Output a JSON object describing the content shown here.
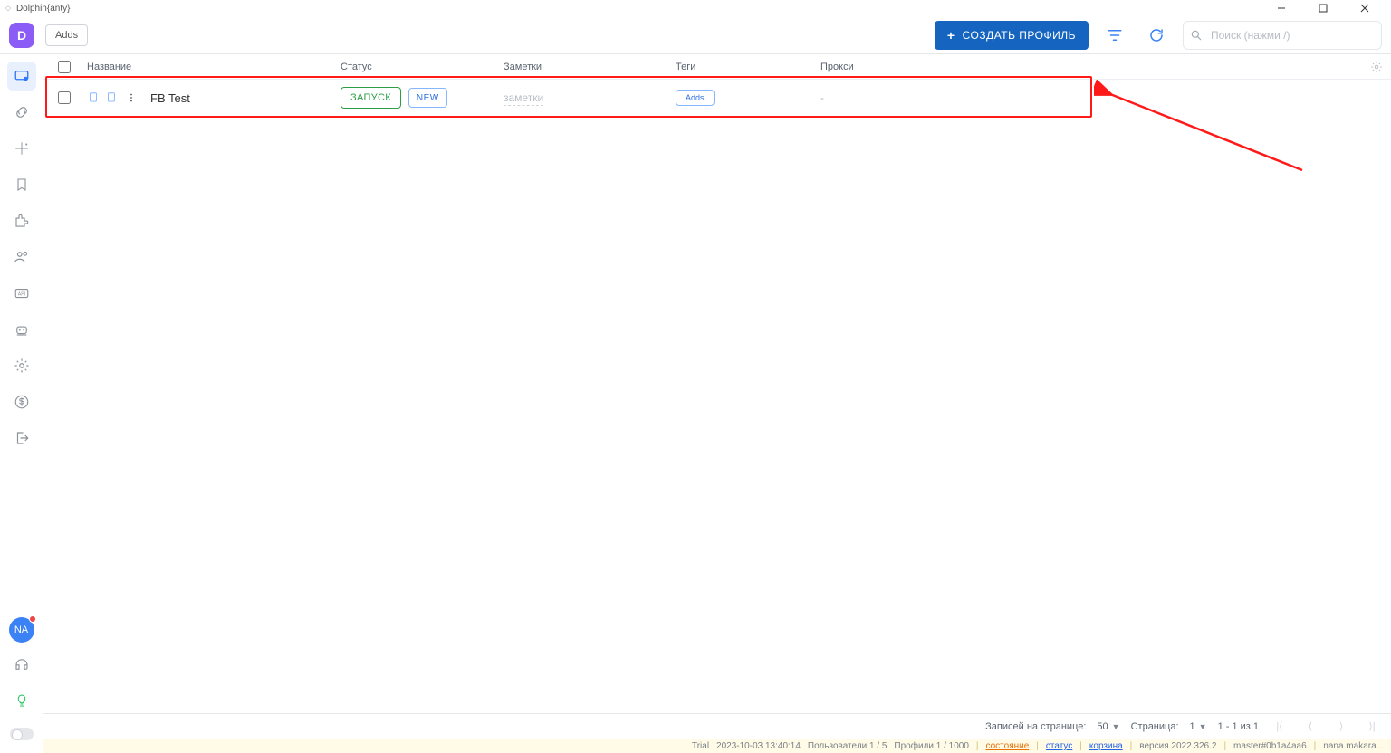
{
  "window": {
    "title": "Dolphin{anty}"
  },
  "topbar": {
    "logo_letter": "D",
    "adds_label": "Adds",
    "create_profile_label": "СОЗДАТЬ ПРОФИЛЬ",
    "search_placeholder": "Поиск (нажми /)"
  },
  "columns": {
    "name": "Название",
    "status": "Статус",
    "notes": "Заметки",
    "tags": "Теги",
    "proxy": "Прокси"
  },
  "row": {
    "name": "FB Test",
    "launch_label": "ЗАПУСК",
    "new_label": "NEW",
    "notes_placeholder": "заметки",
    "tags_add_label": "Adds",
    "proxy_value": "-"
  },
  "sidebar": {
    "avatar_initials": "NA"
  },
  "pager": {
    "per_page_label": "Записей на странице:",
    "per_page_value": "50",
    "page_label": "Страница:",
    "page_value": "1",
    "range_text": "1 - 1 из 1"
  },
  "statusbar": {
    "trial": "Trial",
    "datetime": "2023-10-03 13:40:14",
    "users": "Пользователи 1 / 5",
    "profiles": "Профили 1 / 1000",
    "link_sost": "состояние",
    "link_status": "статус",
    "link_kor": "корзина",
    "version": "версия 2022.326.2",
    "build": "master#0b1a4aa6",
    "user": "nana.makara..."
  }
}
